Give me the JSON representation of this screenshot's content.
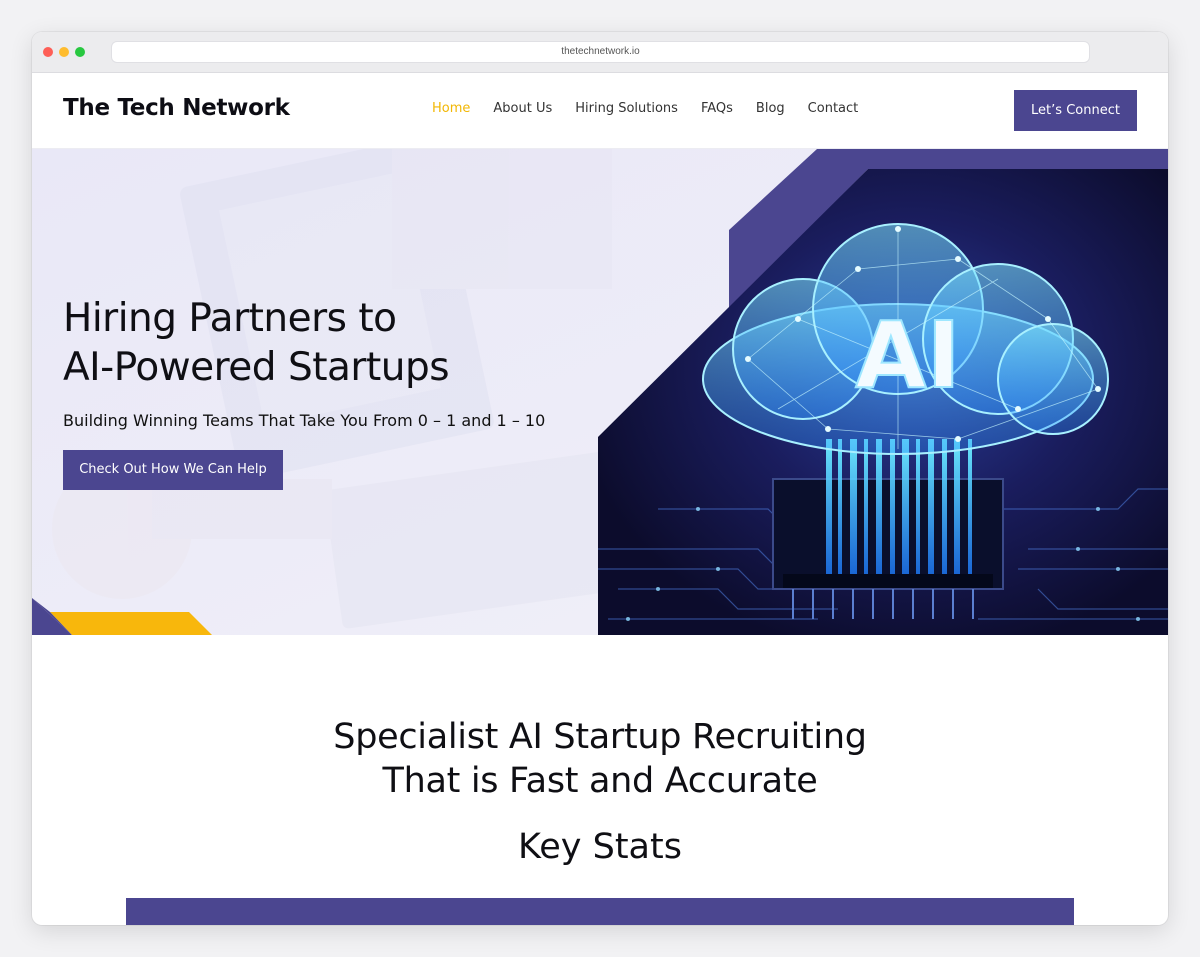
{
  "browser": {
    "url": "thetechnetwork.io"
  },
  "header": {
    "logo": "The Tech Network",
    "nav": [
      {
        "label": "Home",
        "active": true
      },
      {
        "label": "About Us",
        "active": false
      },
      {
        "label": "Hiring Solutions",
        "active": false
      },
      {
        "label": "FAQs",
        "active": false
      },
      {
        "label": "Blog",
        "active": false
      },
      {
        "label": "Contact",
        "active": false
      }
    ],
    "cta_label": "Let’s Connect"
  },
  "hero": {
    "title_line1": "Hiring Partners to",
    "title_line2": "AI-Powered Startups",
    "subtitle": "Building Winning Teams That Take You From 0 – 1 and 1 – 10",
    "button_label": "Check Out How We Can Help",
    "art_label": "AI"
  },
  "section": {
    "title_line1": "Specialist AI Startup Recruiting",
    "title_line2": "That is Fast and Accurate",
    "key_stats": "Key Stats"
  },
  "colors": {
    "brand_purple": "#4b4690",
    "accent_yellow": "#f2b705",
    "hero_bg": "#eeeef8",
    "neon_cyan": "#39d6ff"
  }
}
